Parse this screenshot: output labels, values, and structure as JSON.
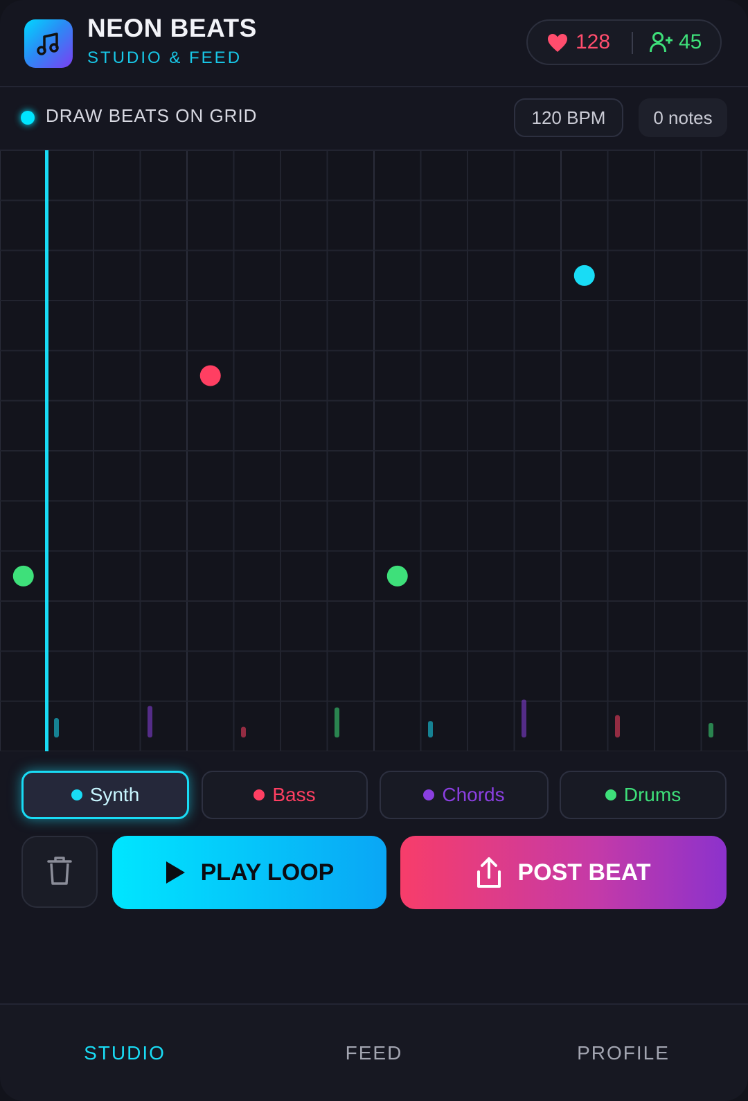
{
  "header": {
    "app_icon": "music-note-icon",
    "title": "NEON BEATS",
    "subtitle": "STUDIO & FEED",
    "likes": "128",
    "followers": "45"
  },
  "toolbar": {
    "instruction": "DRAW BEATS ON GRID",
    "bpm": "120 BPM",
    "notes": "0 notes"
  },
  "grid": {
    "columns": 16,
    "rows": 12,
    "playhead_step": 1,
    "notes": [
      {
        "step": 0,
        "row": 8,
        "instrument": "Drums"
      },
      {
        "step": 4,
        "row": 4,
        "instrument": "Bass"
      },
      {
        "step": 8,
        "row": 8,
        "instrument": "Drums"
      },
      {
        "step": 12,
        "row": 2,
        "instrument": "Synth"
      }
    ],
    "level_meters": [
      {
        "step": 1,
        "level": 0.4,
        "instrument": "Synth"
      },
      {
        "step": 3,
        "level": 0.65,
        "instrument": "Chords"
      },
      {
        "step": 5,
        "level": 0.22,
        "instrument": "Bass"
      },
      {
        "step": 7,
        "level": 0.62,
        "instrument": "Drums"
      },
      {
        "step": 9,
        "level": 0.34,
        "instrument": "Synth"
      },
      {
        "step": 11,
        "level": 0.78,
        "instrument": "Chords"
      },
      {
        "step": 13,
        "level": 0.46,
        "instrument": "Bass"
      },
      {
        "step": 15,
        "level": 0.3,
        "instrument": "Drums"
      }
    ]
  },
  "instruments": [
    {
      "label": "Synth",
      "color": "#19dcf5",
      "active": true
    },
    {
      "label": "Bass",
      "color": "#ff3f62",
      "active": false
    },
    {
      "label": "Chords",
      "color": "#8a3fe0",
      "active": false
    },
    {
      "label": "Drums",
      "color": "#3ee07a",
      "active": false
    }
  ],
  "actions": {
    "clear_icon": "trash-icon",
    "play_label": "PLAY LOOP",
    "post_label": "POST BEAT"
  },
  "nav": {
    "items": [
      {
        "label": "STUDIO",
        "active": true
      },
      {
        "label": "FEED",
        "active": false
      },
      {
        "label": "PROFILE",
        "active": false
      }
    ]
  },
  "colors": {
    "accent": "#19dcf5",
    "likes": "#ff4d6d",
    "followers": "#3ee07a"
  }
}
